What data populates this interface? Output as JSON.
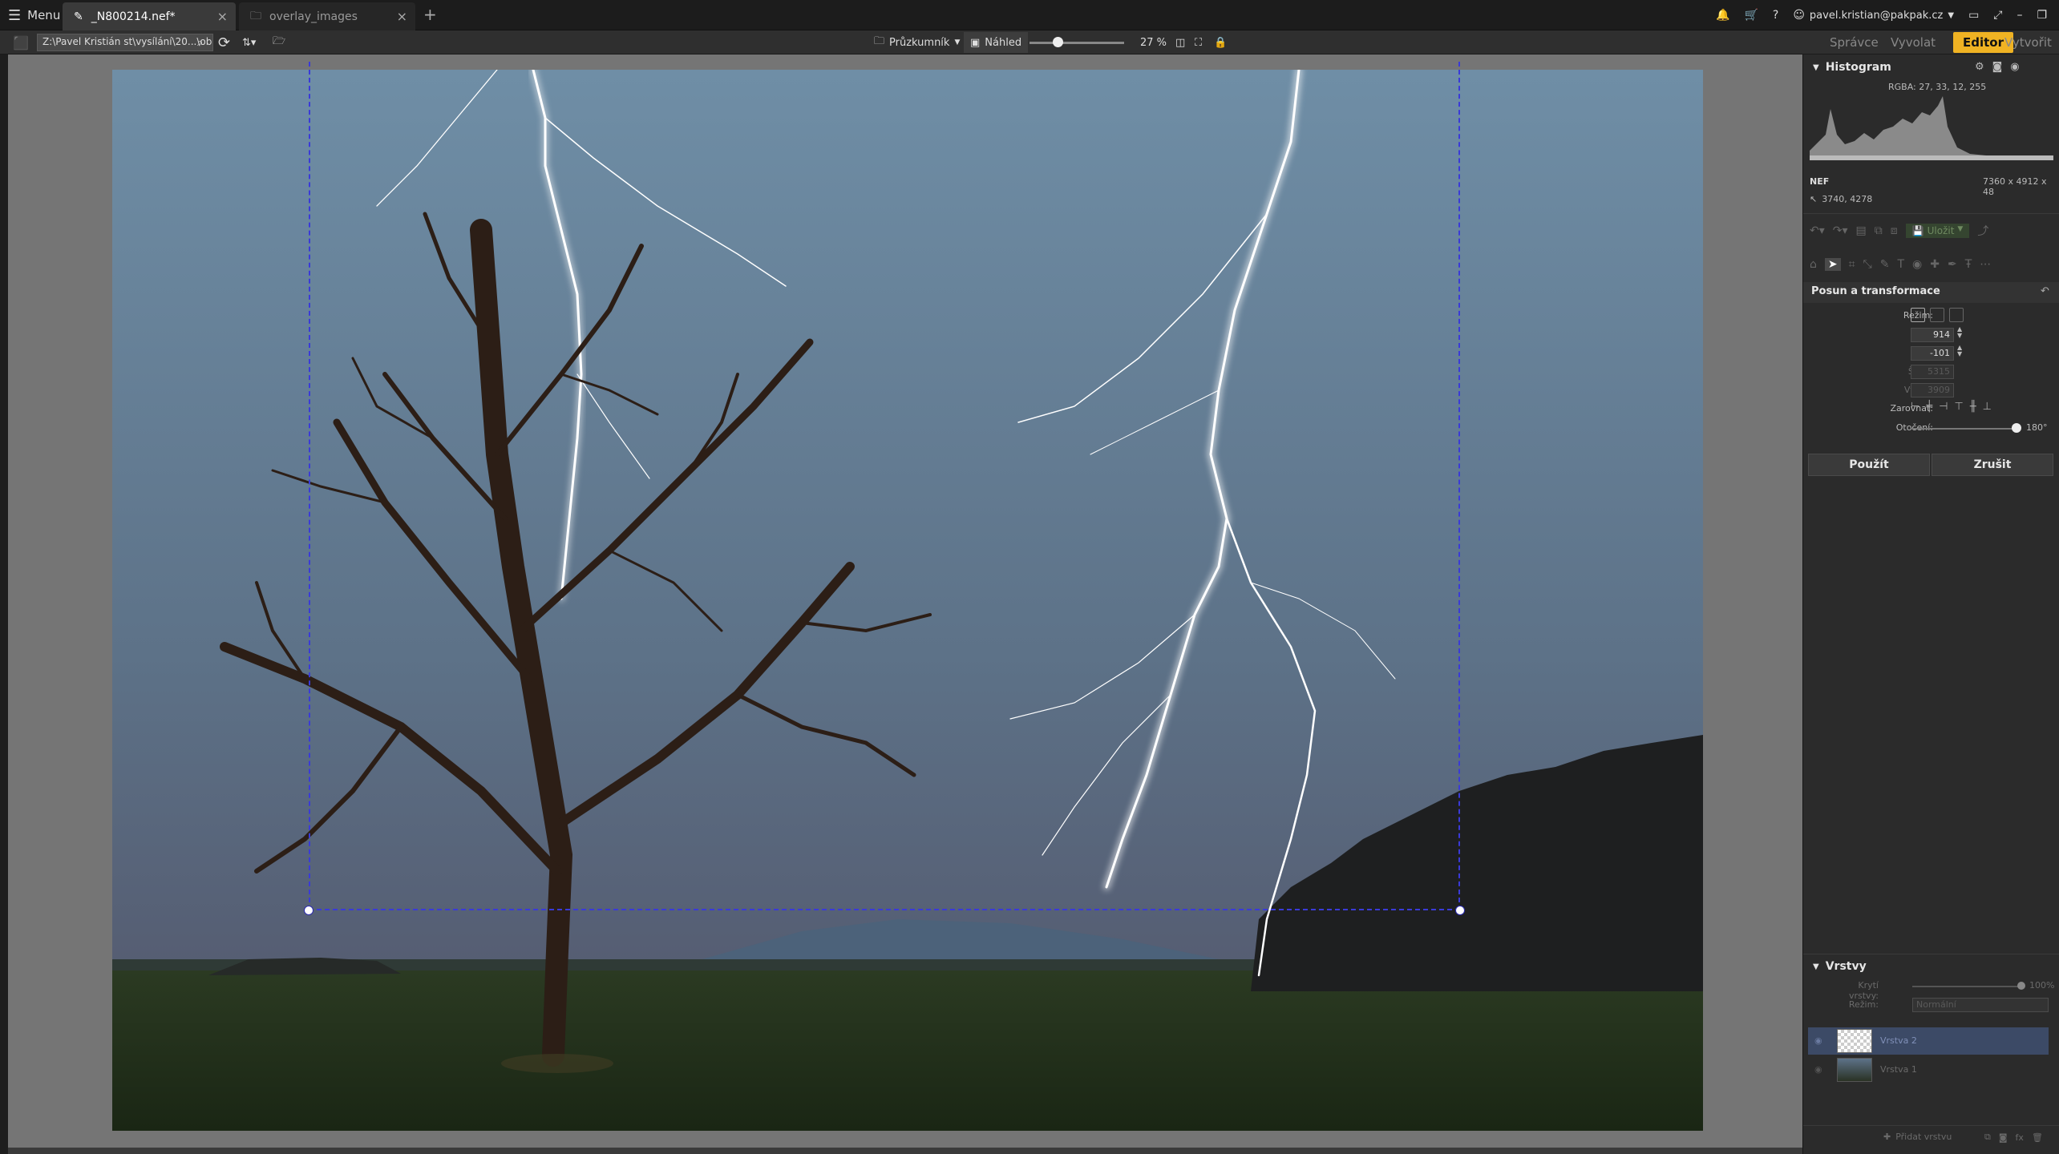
{
  "titlebar": {
    "menu_label": "Menu",
    "tabs": [
      {
        "label": "_N800214.nef*",
        "active": true
      },
      {
        "label": "overlay_images",
        "active": false
      }
    ],
    "user_email": "pavel.kristian@pakpak.cz"
  },
  "toolbar": {
    "path": "Z:\\Pavel Kristián st\\vysílání\\20...\\obr",
    "explorer_label": "Průzkumník",
    "preview_label": "Náhled",
    "zoom_label": "27 %",
    "zoom_fraction": 0.3,
    "modes": [
      "Správce",
      "Vyvolat",
      "Editor",
      "Vytvořit"
    ],
    "active_mode": "Editor"
  },
  "histogram": {
    "title": "Histogram",
    "rgba": "RGBA: 27, 33, 12, 255",
    "format": "NEF",
    "dimensions": "7360 x 4912 x 48",
    "cursor": "3740, 4278"
  },
  "history": {
    "save_label": "Uložit"
  },
  "transform": {
    "title": "Posun a transformace",
    "mode_label": "Režim:",
    "x_label": "X:",
    "x_value": "914",
    "y_label": "Y:",
    "y_value": "-101",
    "width_label": "Šířka:",
    "width_value": "5315",
    "height_label": "Výška:",
    "height_value": "3909",
    "align_label": "Zarovnat:",
    "rotate_label": "Otočení:",
    "rotate_value": "180°",
    "rotate_fraction": 1.0,
    "apply_label": "Použít",
    "cancel_label": "Zrušit"
  },
  "layers": {
    "title": "Vrstvy",
    "opacity_label": "Krytí vrstvy:",
    "opacity_value": "100%",
    "opacity_fraction": 1.0,
    "mode_label": "Režim:",
    "mode_value": "Normální",
    "items": [
      {
        "name": "Vrstva 2",
        "selected": true
      },
      {
        "name": "Vrstva 1",
        "selected": false
      }
    ],
    "add_label": "Přidat vrstvu"
  }
}
